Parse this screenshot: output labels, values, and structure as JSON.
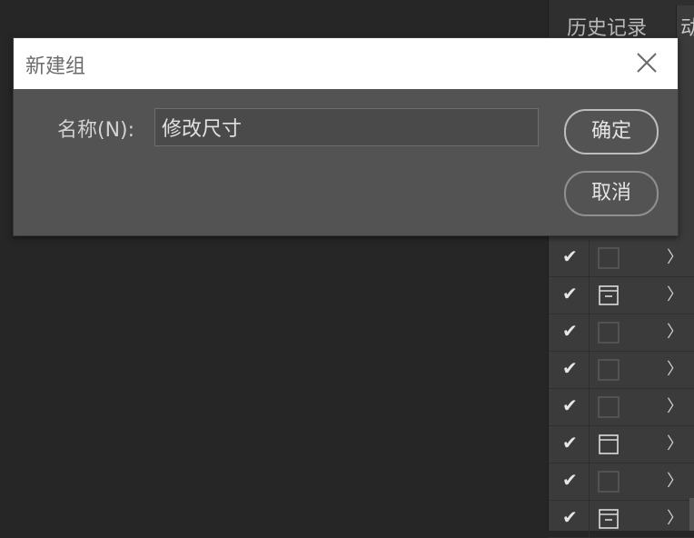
{
  "panel": {
    "tabs": {
      "history": "历史记录",
      "actions": "动"
    },
    "rows": [
      {
        "checked": true,
        "icon": "empty-box-icon"
      },
      {
        "checked": true,
        "icon": "set-folder-icon"
      },
      {
        "checked": true,
        "icon": "empty-box-icon"
      },
      {
        "checked": true,
        "icon": "empty-box-icon"
      },
      {
        "checked": true,
        "icon": "empty-box-icon"
      },
      {
        "checked": true,
        "icon": "dialog-box-icon"
      },
      {
        "checked": true,
        "icon": "empty-box-icon"
      },
      {
        "checked": true,
        "icon": "set-folder-icon"
      }
    ],
    "check_glyph": "✔",
    "chevron_glyph": "〉"
  },
  "dialog": {
    "title": "新建组",
    "name_label": "名称(N):",
    "name_value": "修改尺寸",
    "ok_label": "确定",
    "cancel_label": "取消"
  }
}
